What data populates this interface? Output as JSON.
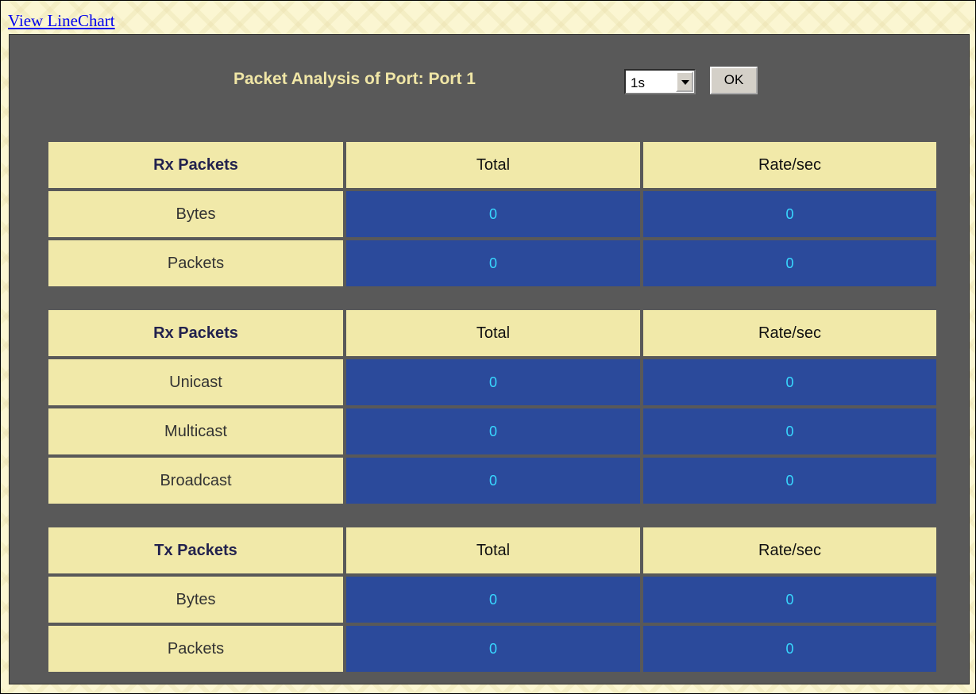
{
  "top_link": "View LineChart",
  "panel": {
    "title": "Packet Analysis of Port: Port 1",
    "interval_select": {
      "value": "1s"
    },
    "ok_label": "OK"
  },
  "tables": [
    {
      "headers": [
        "Rx Packets",
        "Total",
        "Rate/sec"
      ],
      "rows": [
        {
          "label": "Bytes",
          "total": "0",
          "rate": "0"
        },
        {
          "label": "Packets",
          "total": "0",
          "rate": "0"
        }
      ]
    },
    {
      "headers": [
        "Rx Packets",
        "Total",
        "Rate/sec"
      ],
      "rows": [
        {
          "label": "Unicast",
          "total": "0",
          "rate": "0"
        },
        {
          "label": "Multicast",
          "total": "0",
          "rate": "0"
        },
        {
          "label": "Broadcast",
          "total": "0",
          "rate": "0"
        }
      ]
    },
    {
      "headers": [
        "Tx Packets",
        "Total",
        "Rate/sec"
      ],
      "rows": [
        {
          "label": "Bytes",
          "total": "0",
          "rate": "0"
        },
        {
          "label": "Packets",
          "total": "0",
          "rate": "0"
        }
      ]
    }
  ],
  "colors": {
    "panel_bg": "#595959",
    "header_cell_bg": "#f1e9a9",
    "value_cell_bg": "#2b4a9b",
    "value_text": "#38d7ff",
    "title_text": "#f0e6a6"
  }
}
